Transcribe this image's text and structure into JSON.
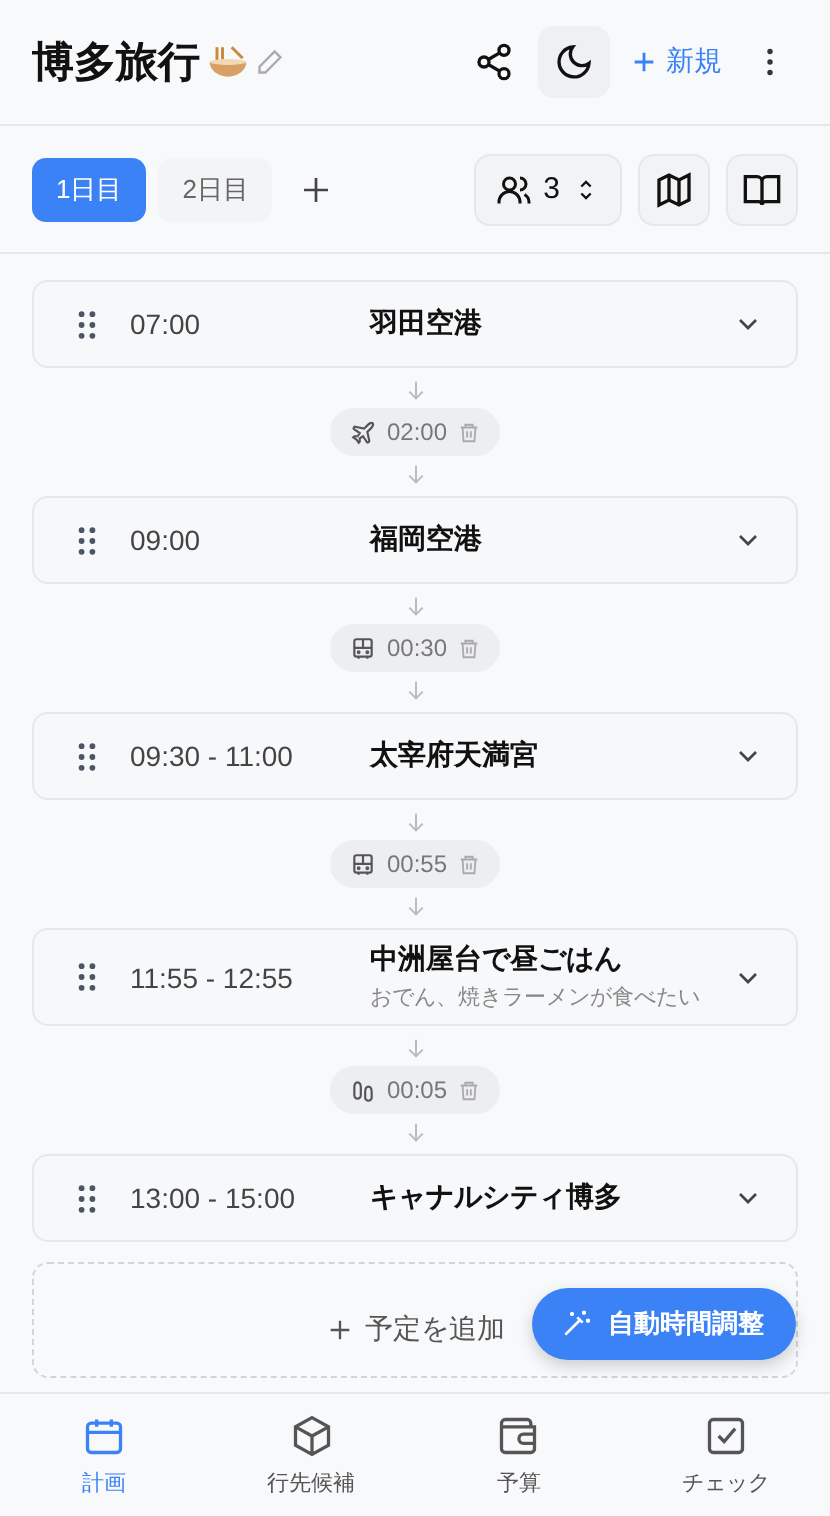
{
  "header": {
    "title": "博多旅行",
    "new_label": "新規"
  },
  "days": [
    {
      "label": "1日目",
      "selected": true
    },
    {
      "label": "2日目",
      "selected": false
    }
  ],
  "people": {
    "count": "3"
  },
  "schedule": [
    {
      "kind": "stop",
      "time": "07:00",
      "name": "羽田空港"
    },
    {
      "kind": "plane",
      "duration": "02:00"
    },
    {
      "kind": "stop",
      "time": "09:00",
      "name": "福岡空港"
    },
    {
      "kind": "train",
      "duration": "00:30"
    },
    {
      "kind": "stop",
      "time": "09:30 - 11:00",
      "name": "太宰府天満宮"
    },
    {
      "kind": "train",
      "duration": "00:55"
    },
    {
      "kind": "stop",
      "time": "11:55 - 12:55",
      "name": "中洲屋台で昼ごはん",
      "note": "おでん、焼きラーメンが食べたい"
    },
    {
      "kind": "walk",
      "duration": "00:05"
    },
    {
      "kind": "stop",
      "time": "13:00 - 15:00",
      "name": "キャナルシティ博多"
    }
  ],
  "add_label": "予定を追加",
  "auto_button": "自動時間調整",
  "nav": [
    {
      "label": "計画",
      "kind": "calendar",
      "selected": true
    },
    {
      "label": "行先候補",
      "kind": "box",
      "selected": false
    },
    {
      "label": "予算",
      "kind": "wallet",
      "selected": false
    },
    {
      "label": "チェック",
      "kind": "check",
      "selected": false
    }
  ]
}
